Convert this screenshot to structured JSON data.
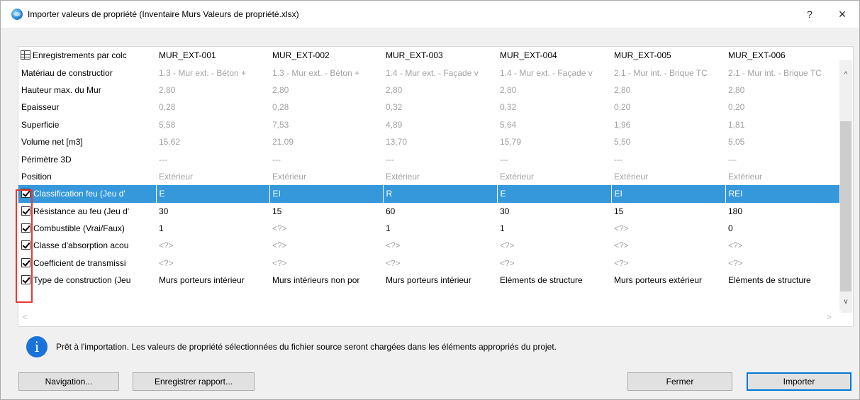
{
  "window": {
    "title": "Importer valeurs de propriété (Inventaire Murs Valeurs de propriété.xlsx)",
    "help_label": "?",
    "close_label": "×"
  },
  "grid": {
    "header": {
      "label": "Enregistrements par colc",
      "columns": [
        "MUR_EXT-001",
        "MUR_EXT-002",
        "MUR_EXT-003",
        "MUR_EXT-004",
        "MUR_EXT-005",
        "MUR_EXT-006"
      ]
    },
    "readonly_rows": [
      {
        "label": "Matériau de constructior",
        "values": [
          "1.3 - Mur ext. - Béton +",
          "1.3 - Mur ext. - Béton +",
          "1.4 - Mur ext. - Façade v",
          "1.4 - Mur ext. - Façade v",
          "2.1 - Mur int. - Brique TC",
          "2.1 - Mur int. - Brique TC"
        ]
      },
      {
        "label": "Hauteur max. du Mur",
        "values": [
          "2,80",
          "2,80",
          "2,80",
          "2,80",
          "2,80",
          "2,80"
        ]
      },
      {
        "label": "Epaisseur",
        "values": [
          "0,28",
          "0,28",
          "0,32",
          "0,32",
          "0,20",
          "0,20"
        ]
      },
      {
        "label": "Superficie",
        "values": [
          "5,58",
          "7,53",
          "4,89",
          "5,64",
          "1,96",
          "1,81"
        ]
      },
      {
        "label": "Volume net [m3]",
        "values": [
          "15,62",
          "21,09",
          "13,70",
          "15,79",
          "5,50",
          "5,05"
        ]
      },
      {
        "label": "Périmètre 3D",
        "values": [
          "---",
          "---",
          "---",
          "---",
          "---",
          "---"
        ]
      },
      {
        "label": "Position",
        "values": [
          "Extérieur",
          "Extérieur",
          "Extérieur",
          "Extérieur",
          "Extérieur",
          "Extérieur"
        ]
      }
    ],
    "import_rows": [
      {
        "label": "Classification feu (Jeu d'",
        "values": [
          "E",
          "EI",
          "R",
          "E",
          "EI",
          "REI"
        ],
        "checked": true,
        "selected": true
      },
      {
        "label": "Résistance au feu (Jeu d'",
        "values": [
          "30",
          "15",
          "60",
          "30",
          "15",
          "180"
        ],
        "checked": true,
        "selected": false
      },
      {
        "label": "Combustible (Vrai/Faux)",
        "values": [
          "1",
          "<?>",
          "1",
          "1",
          "<?>",
          "0"
        ],
        "checked": true,
        "selected": false
      },
      {
        "label": "Classe d'absorption acou",
        "values": [
          "<?>",
          "<?>",
          "<?>",
          "<?>",
          "<?>",
          "<?>"
        ],
        "checked": true,
        "selected": false
      },
      {
        "label": "Coefficient de transmissi",
        "values": [
          "<?>",
          "<?>",
          "<?>",
          "<?>",
          "<?>",
          "<?>"
        ],
        "checked": true,
        "selected": false
      },
      {
        "label": "Type de construction (Jeu",
        "values": [
          "Murs porteurs intérieur",
          "Murs intérieurs non por",
          "Murs porteurs intérieur",
          "Eléments de structure",
          "Murs porteurs extérieur",
          "Eléments de structure"
        ],
        "checked": true,
        "selected": false
      }
    ]
  },
  "scroll": {
    "up": "^",
    "down": "v",
    "left": "<",
    "right": ">"
  },
  "info": {
    "icon": "i",
    "message": "Prêt à l'importation. Les valeurs de propriété sélectionnées du fichier source seront chargées dans les éléments appropriés du projet."
  },
  "buttons": {
    "navigation": "Navigation...",
    "save_report": "Enregistrer rapport...",
    "close": "Fermer",
    "import": "Importer"
  },
  "colors": {
    "selection": "#3498db",
    "highlight_box": "#e53935",
    "info_icon": "#1a73d9"
  }
}
